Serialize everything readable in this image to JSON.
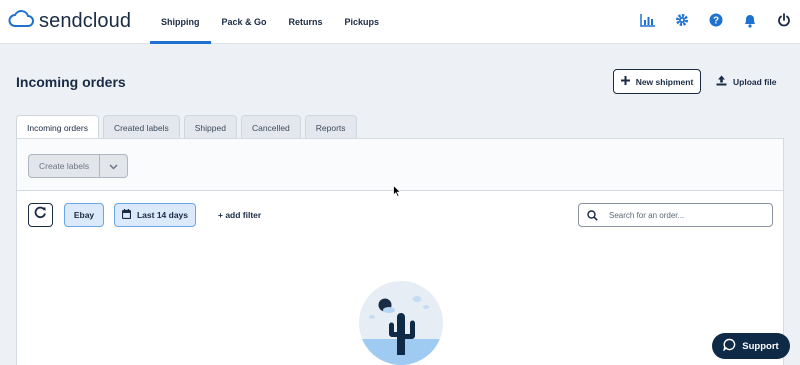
{
  "app": {
    "brand": "sendcloud",
    "accent": "#1f71d1",
    "navy": "#1a2b44"
  },
  "nav": {
    "items": [
      "Shipping",
      "Pack & Go",
      "Returns",
      "Pickups"
    ],
    "active": "Shipping",
    "icons": [
      "analytics-icon",
      "gear-icon",
      "help-icon",
      "bell-icon",
      "power-icon"
    ]
  },
  "header": {
    "title": "Incoming orders",
    "new_shipment": "New shipment",
    "upload_file": "Upload file"
  },
  "tabs": [
    "Incoming orders",
    "Created labels",
    "Shipped",
    "Cancelled",
    "Reports"
  ],
  "actions": {
    "create_labels": "Create labels"
  },
  "filters": {
    "integration": "Ebay",
    "date_range": "Last 14 days",
    "add_filter": "+ add filter",
    "search_placeholder": "Search for an order..."
  },
  "support": {
    "label": "Support"
  }
}
